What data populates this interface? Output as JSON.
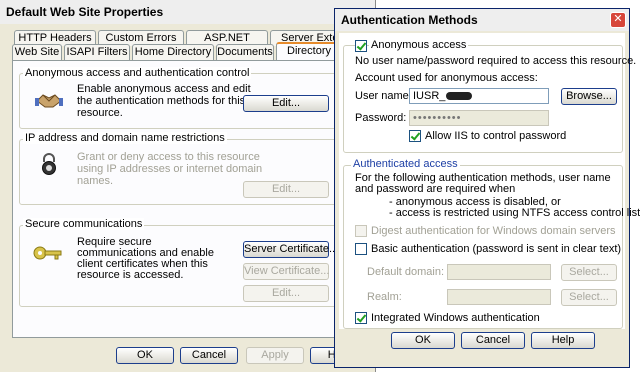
{
  "left_window": {
    "title": "Default Web Site Properties",
    "tabs_row1": [
      "HTTP Headers",
      "Custom Errors",
      "ASP.NET",
      "Server Extensions"
    ],
    "tabs_row2": [
      "Web Site",
      "ISAPI Filters",
      "Home Directory",
      "Documents",
      "Directory Security"
    ],
    "anon_group": {
      "title": "Anonymous access and authentication control",
      "text": "Enable anonymous access and edit the authentication methods for this resource.",
      "edit_label": "Edit..."
    },
    "ip_group": {
      "title": "IP address and domain name restrictions",
      "text": "Grant or deny access to this resource using IP addresses or internet domain names.",
      "edit_label": "Edit..."
    },
    "secure_group": {
      "title": "Secure communications",
      "text": "Require secure communications and enable client certificates when this resource is accessed.",
      "server_cert_label": "Server Certificate...",
      "view_cert_label": "View Certificate...",
      "edit_label": "Edit..."
    },
    "buttons": {
      "ok": "OK",
      "cancel": "Cancel",
      "apply": "Apply",
      "help": "Help"
    }
  },
  "auth_dialog": {
    "title": "Authentication Methods",
    "close_glyph": "✕",
    "anonymous": {
      "checkbox_label": "Anonymous access",
      "checked": true,
      "note": "No user name/password required to access this resource.",
      "account_heading": "Account used for anonymous access:",
      "username_label": "User name:",
      "username_value": "IUSR_",
      "browse_label": "Browse...",
      "password_label": "Password:",
      "password_value": "••••••••••",
      "allow_iis_label": "Allow IIS to control password",
      "allow_iis_checked": true
    },
    "authenticated": {
      "title": "Authenticated access",
      "description": "For the following authentication methods, user name and password are required when",
      "bullet1": "- anonymous access is disabled, or",
      "bullet2": "- access is restricted using NTFS access control lists",
      "digest_label": "Digest authentication for Windows domain servers",
      "basic_label": "Basic authentication (password is sent in clear text)",
      "default_domain_label": "Default domain:",
      "realm_label": "Realm:",
      "select_label": "Select...",
      "integrated_label": "Integrated Windows authentication",
      "integrated_checked": true
    },
    "buttons": {
      "ok": "OK",
      "cancel": "Cancel",
      "help": "Help"
    }
  }
}
